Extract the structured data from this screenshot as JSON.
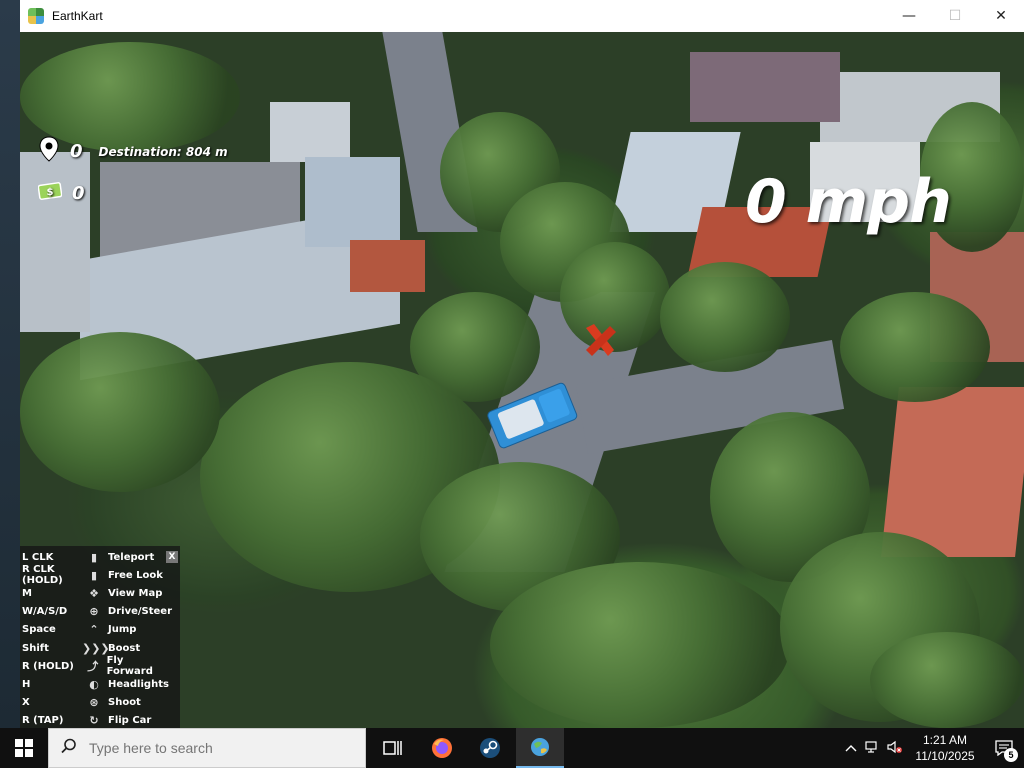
{
  "window": {
    "title": "EarthKart",
    "controls": {
      "minimize": "—",
      "maximize": "☐",
      "close": "✕"
    }
  },
  "hud": {
    "score": "0",
    "destination": "Destination: 804 m",
    "money": "0",
    "speed": "0 mph"
  },
  "controls_panel": {
    "close_label": "X",
    "rows": [
      {
        "key": "L CLK",
        "action": "Teleport",
        "icon": "mouse-left-icon"
      },
      {
        "key": "R CLK (HOLD)",
        "action": "Free Look",
        "icon": "mouse-right-icon"
      },
      {
        "key": "M",
        "action": "View Map",
        "icon": "map-icon"
      },
      {
        "key": "W/A/S/D",
        "action": "Drive/Steer",
        "icon": "steering-wheel-icon"
      },
      {
        "key": "Space",
        "action": "Jump",
        "icon": "jump-icon"
      },
      {
        "key": "Shift",
        "action": "Boost",
        "icon": "boost-icon"
      },
      {
        "key": "R (HOLD)",
        "action": "Fly Forward",
        "icon": "fly-icon"
      },
      {
        "key": "H",
        "action": "Headlights",
        "icon": "headlights-icon"
      },
      {
        "key": "X",
        "action": "Shoot",
        "icon": "crosshair-icon"
      },
      {
        "key": "R (TAP)",
        "action": "Flip Car",
        "icon": "flip-icon"
      }
    ]
  },
  "taskbar": {
    "search_placeholder": "Type here to search",
    "time": "1:21 AM",
    "date": "11/10/2025",
    "notification_count": "5"
  }
}
